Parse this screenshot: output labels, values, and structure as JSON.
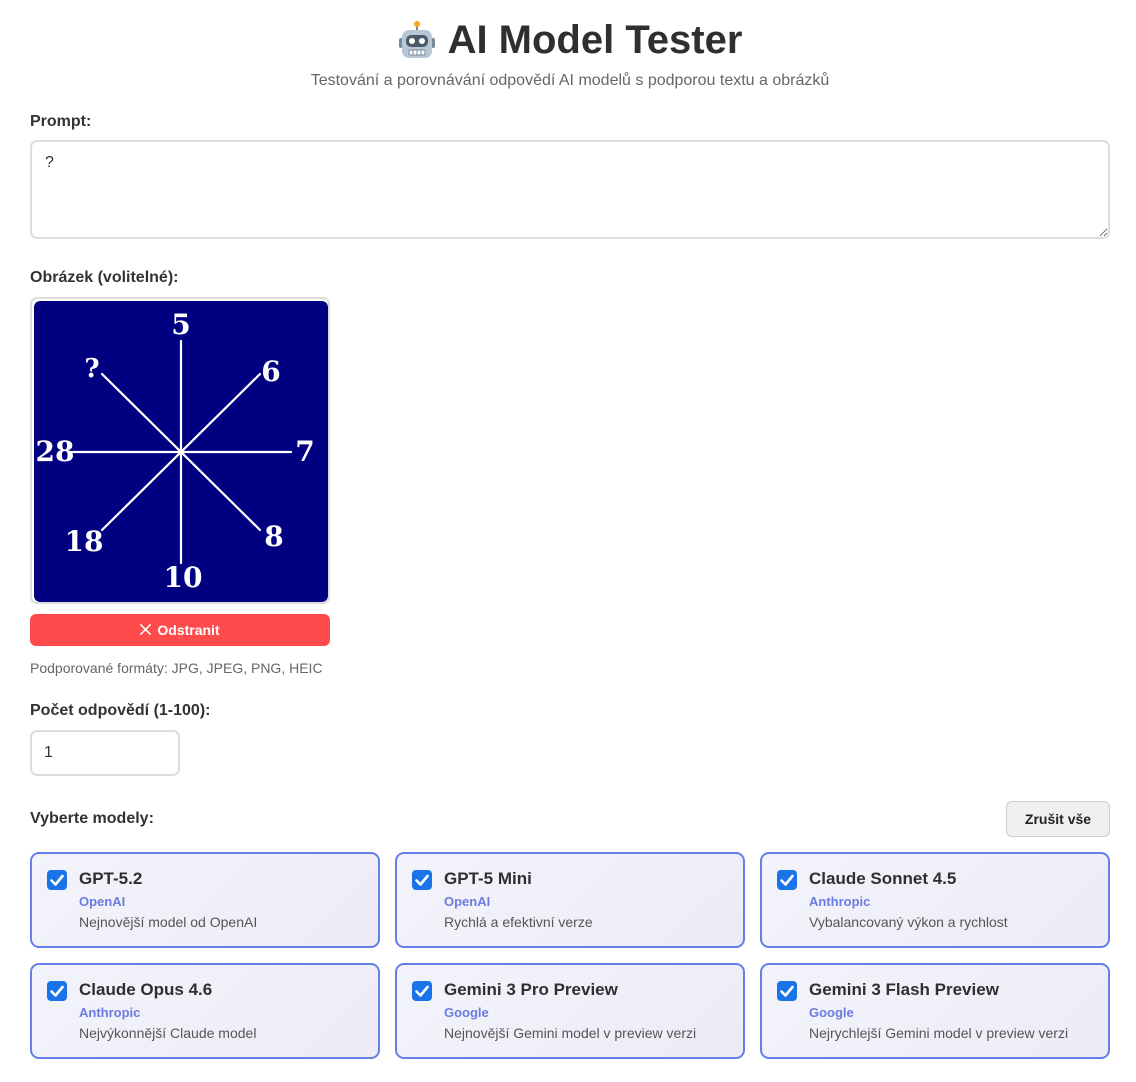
{
  "header": {
    "title": "AI Model Tester",
    "subtitle": "Testování a porovnávání odpovědí AI modelů s podporou textu a obrázků"
  },
  "prompt": {
    "label": "Prompt:",
    "value": "?"
  },
  "image": {
    "label": "Obrázek (volitelné):",
    "puzzle_numbers": {
      "top": "5",
      "top_right": "6",
      "right": "7",
      "bottom_right": "8",
      "bottom": "10",
      "bottom_left": "18",
      "left": "28",
      "top_left": "?"
    },
    "remove_label": "Odstranit",
    "formats_hint": "Podporované formáty: JPG, JPEG, PNG, HEIC"
  },
  "count": {
    "label": "Počet odpovědí (1-100):",
    "value": "1"
  },
  "models": {
    "label": "Vyberte modely:",
    "clear_all_label": "Zrušit vše",
    "items": [
      {
        "name": "GPT-5.2",
        "provider": "OpenAI",
        "description": "Nejnovější model od OpenAI",
        "checked": true
      },
      {
        "name": "GPT-5 Mini",
        "provider": "OpenAI",
        "description": "Rychlá a efektivní verze",
        "checked": true
      },
      {
        "name": "Claude Sonnet 4.5",
        "provider": "Anthropic",
        "description": "Vybalancovaný výkon a rychlost",
        "checked": true
      },
      {
        "name": "Claude Opus 4.6",
        "provider": "Anthropic",
        "description": "Nejvýkonnější Claude model",
        "checked": true
      },
      {
        "name": "Gemini 3 Pro Preview",
        "provider": "Google",
        "description": "Nejnovější Gemini model v preview verzi",
        "checked": true
      },
      {
        "name": "Gemini 3 Flash Preview",
        "provider": "Google",
        "description": "Nejrychlejší Gemini model v preview verzi",
        "checked": true
      }
    ]
  },
  "colors": {
    "accent": "#667eea",
    "checkbox": "#1a73e8",
    "danger": "#ff4b4b",
    "puzzle_background": "#000080"
  }
}
